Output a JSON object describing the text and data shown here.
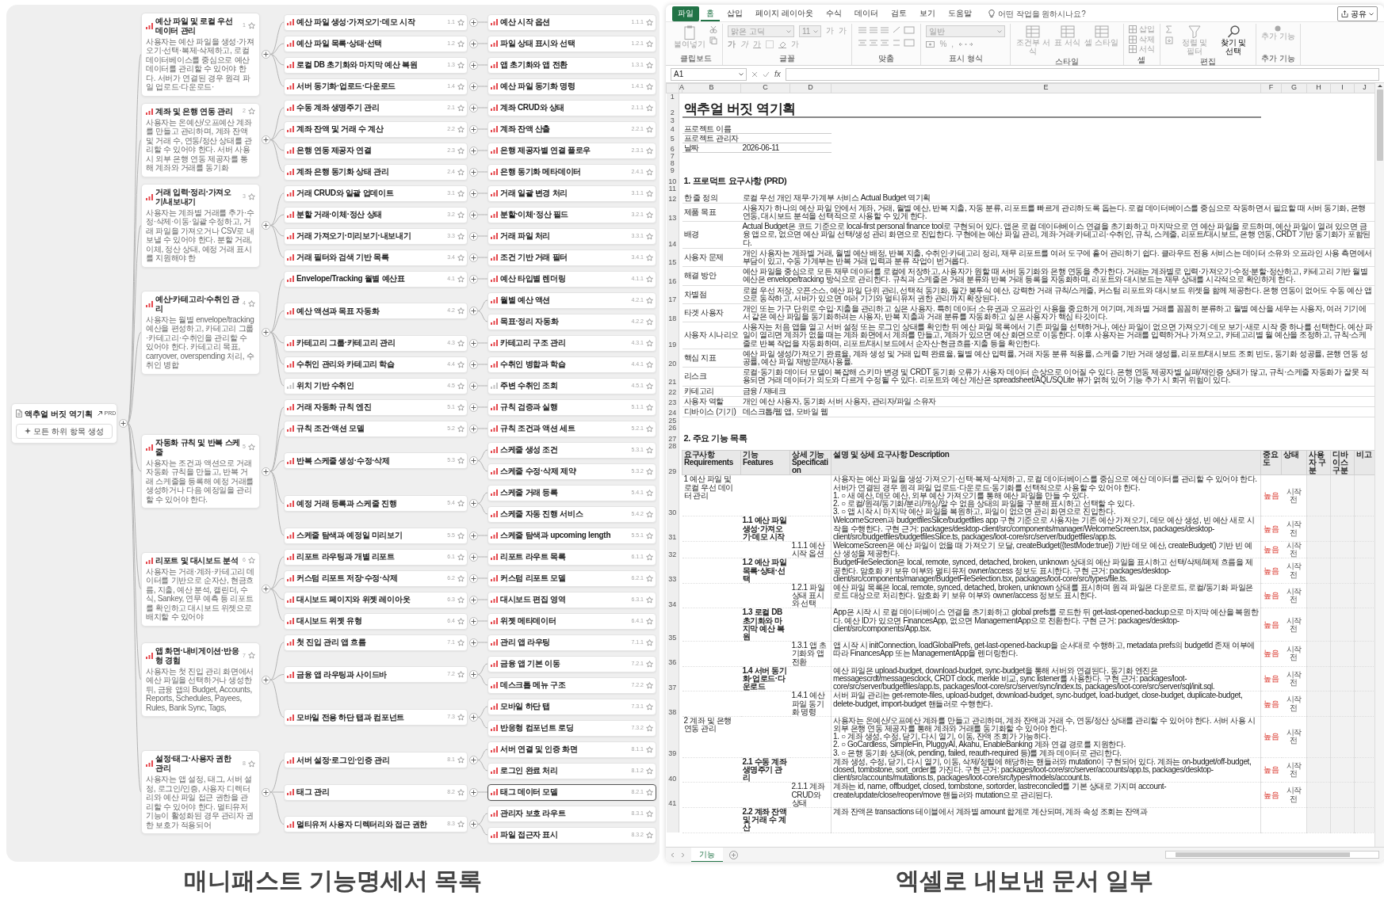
{
  "mindmap": {
    "caption": "매니패스트 기능명세서 목록",
    "root": {
      "title": "액추얼 버짓 역기획",
      "badge": "PRD",
      "action": "모든 하위 항목 생성"
    },
    "features": [
      {
        "number": "1",
        "title": "예산 파일 및 로컬 우선 데이터 관리",
        "color": "#e5484d",
        "description": "사용자는 예산 파일을 생성·가져오기·선택·복제·삭제하고, 로컬 데이터베이스를 중심으로 예산 데이터를 관리할 수 있어야 한다. 서버가 연결된 경우 원격 파일 업로드·다운로드·",
        "children": [
          {
            "number": "1.1",
            "title": "예산 파일 생성·가져오기·데모 시작",
            "color": "#e5484d",
            "children": [
              {
                "number": "1.1.1",
                "title": "예산 시작 옵션",
                "color": "#e5484d",
                "selected": false
              }
            ]
          },
          {
            "number": "1.2",
            "title": "예산 파일 목록·상태·선택",
            "color": "#e5484d",
            "children": [
              {
                "number": "1.2.1",
                "title": "파일 상태 표시와 선택",
                "color": "#e5484d",
                "selected": false
              }
            ]
          },
          {
            "number": "1.3",
            "title": "로컬 DB 초기화와 마지막 예산 복원",
            "color": "#e5484d",
            "children": [
              {
                "number": "1.3.1",
                "title": "앱 초기화와 앱 전환",
                "color": "#e5484d",
                "selected": false
              }
            ]
          },
          {
            "number": "1.4",
            "title": "서버 동기화·업로드·다운로드",
            "color": "#e5484d",
            "children": [
              {
                "number": "1.4.1",
                "title": "예산 파일 동기화 명령",
                "color": "#e5484d",
                "selected": false
              }
            ]
          }
        ]
      },
      {
        "number": "2",
        "title": "계좌 및 은행 연동 관리",
        "color": "#e5484d",
        "description": "사용자는 온예산/오프예산 계좌를 만들고 관리하며, 계좌 잔액 및 거래 수, 연동/정산 상태를 관리할 수 있어야 한다. 서버 사용 시 외부 은행 연동 제공자를 통해 계좌와 거래를 동기화",
        "children": [
          {
            "number": "2.1",
            "title": "수동 계좌 생명주기 관리",
            "color": "#e5484d",
            "children": [
              {
                "number": "2.1.1",
                "title": "계좌 CRUD와 상태",
                "color": "#e5484d",
                "selected": false
              }
            ]
          },
          {
            "number": "2.2",
            "title": "계좌 잔액 및 거래 수 계산",
            "color": "#e5484d",
            "children": [
              {
                "number": "2.2.1",
                "title": "계좌 잔액 산출",
                "color": "#e5484d",
                "selected": false
              }
            ]
          },
          {
            "number": "2.3",
            "title": "은행 연동 제공자 연결",
            "color": "#e5484d",
            "children": [
              {
                "number": "2.3.1",
                "title": "은행 제공자별 연결 플로우",
                "color": "#e5484d",
                "selected": false
              }
            ]
          },
          {
            "number": "2.4",
            "title": "계좌 은행 동기화 상태 관리",
            "color": "#e5484d",
            "children": [
              {
                "number": "2.4.1",
                "title": "은행 동기화 메타데이터",
                "color": "#e5484d",
                "selected": false
              }
            ]
          }
        ]
      },
      {
        "number": "3",
        "title": "거래 입력·정리·가져오기/내보내기",
        "color": "#e5484d",
        "description": "사용자는 계좌별 거래를 추가·수정·삭제·이동·일괄 수정하고, 거래 파일을 가져오거나 CSV로 내보낼 수 있어야 한다. 분할 거래, 이체, 정산 상태, 예정 거래 표시를 지원해야 한",
        "children": [
          {
            "number": "3.1",
            "title": "거래 CRUD와 일괄 업데이트",
            "color": "#e5484d",
            "children": [
              {
                "number": "3.1.1",
                "title": "거래 일괄 변경 처리",
                "color": "#e5484d",
                "selected": false
              }
            ]
          },
          {
            "number": "3.2",
            "title": "분할 거래·이체·정산 상태",
            "color": "#e5484d",
            "children": [
              {
                "number": "3.2.1",
                "title": "분할·이체·정산 필드",
                "color": "#e5484d",
                "selected": false
              }
            ]
          },
          {
            "number": "3.3",
            "title": "거래 가져오기·미리보기·내보내기",
            "color": "#e5484d",
            "children": [
              {
                "number": "3.3.1",
                "title": "거래 파일 처리",
                "color": "#e5484d",
                "selected": false
              }
            ]
          },
          {
            "number": "3.4",
            "title": "거래 필터와 검색 기반 목록",
            "color": "#e5484d",
            "children": [
              {
                "number": "3.4.1",
                "title": "조건 기반 거래 필터",
                "color": "#e5484d",
                "selected": false
              }
            ]
          }
        ]
      },
      {
        "number": "4",
        "title": "예산·카테고리·수취인 관리",
        "color": "#e5484d",
        "description": "사용자는 월별 envelope/tracking 예산을 편성하고, 카테고리 그룹·카테고리·수취인을 관리할 수 있어야 한다. 카테고리 목표, carryover, overspending 처리, 수취인 병합",
        "children": [
          {
            "number": "4.1",
            "title": "Envelope/Tracking 월별 예산표",
            "color": "#e5484d",
            "children": [
              {
                "number": "4.1.1",
                "title": "예산 타입별 렌더링",
                "color": "#e5484d",
                "selected": false
              }
            ]
          },
          {
            "number": "4.2",
            "title": "예산 액션과 목표 자동화",
            "color": "#e5484d",
            "children": [
              {
                "number": "4.2.1",
                "title": "월별 예산 액션",
                "color": "#e5484d",
                "selected": false
              },
              {
                "number": "4.2.2",
                "title": "목표·정리 자동화",
                "color": "#e5484d",
                "selected": false
              }
            ]
          },
          {
            "number": "4.3",
            "title": "카테고리 그룹·카테고리 관리",
            "color": "#e5484d",
            "children": [
              {
                "number": "4.3.1",
                "title": "카테고리 구조 관리",
                "color": "#e5484d",
                "selected": false
              }
            ]
          },
          {
            "number": "4.4",
            "title": "수취인 관리와 카테고리 학습",
            "color": "#e5484d",
            "children": [
              {
                "number": "4.4.1",
                "title": "수취인 병합과 학습",
                "color": "#e5484d",
                "selected": false
              }
            ]
          },
          {
            "number": "4.5",
            "title": "위치 기반 수취인",
            "color": "#c4c4c4",
            "children": [
              {
                "number": "4.5.1",
                "title": "주변 수취인 조회",
                "color": "#c4c4c4",
                "selected": false
              }
            ]
          }
        ]
      },
      {
        "number": "5",
        "title": "자동화 규칙 및 반복 스케줄",
        "color": "#e5484d",
        "description": "사용자는 조건과 액션으로 거래 자동화 규칙을 만들고, 반복 거래 스케줄을 등록해 예정 거래를 생성하거나 다음 예정일을 관리할 수 있어야 한다.",
        "children": [
          {
            "number": "5.1",
            "title": "거래 자동화 규칙 엔진",
            "color": "#e5484d",
            "children": [
              {
                "number": "5.1.1",
                "title": "규칙 검증과 실행",
                "color": "#e5484d",
                "selected": false
              }
            ]
          },
          {
            "number": "5.2",
            "title": "규칙 조건·액션 모델",
            "color": "#e5484d",
            "children": [
              {
                "number": "5.2.1",
                "title": "규칙 조건과 액션 세트",
                "color": "#e5484d",
                "selected": false
              }
            ]
          },
          {
            "number": "5.3",
            "title": "반복 스케줄 생성·수정·삭제",
            "color": "#e5484d",
            "children": [
              {
                "number": "5.3.1",
                "title": "스케줄 생성 조건",
                "color": "#e5484d",
                "selected": false
              },
              {
                "number": "5.3.2",
                "title": "스케줄 수정·삭제 제약",
                "color": "#e5484d",
                "selected": false
              }
            ]
          },
          {
            "number": "5.4",
            "title": "예정 거래 등록과 스케줄 진행",
            "color": "#e5484d",
            "children": [
              {
                "number": "5.4.1",
                "title": "스케줄 거래 등록",
                "color": "#e5484d",
                "selected": false
              },
              {
                "number": "5.4.2",
                "title": "스케줄 자동 진행 서비스",
                "color": "#e5484d",
                "selected": false
              }
            ]
          },
          {
            "number": "5.5",
            "title": "스케줄 탐색과 예정일 미리보기",
            "color": "#e5484d",
            "children": [
              {
                "number": "5.5.1",
                "title": "스케줄 탐색과 upcoming length",
                "color": "#e5484d",
                "selected": false
              }
            ]
          }
        ]
      },
      {
        "number": "6",
        "title": "리포트 및 대시보드 분석",
        "color": "#e5484d",
        "description": "사용자는 거래·계좌·카테고리 데이터를 기반으로 순자산, 현금흐름, 지출, 예산 분석, 캘린더, 수식, Sankey, 연무 예측 등 리포트를 확인하고 대시보드 위젯으로 배치할 수 있어야",
        "children": [
          {
            "number": "6.1",
            "title": "리포트 라우팅과 개별 리포트",
            "color": "#e5484d",
            "children": [
              {
                "number": "6.1.1",
                "title": "리포트 라우트 목록",
                "color": "#e5484d",
                "selected": false
              }
            ]
          },
          {
            "number": "6.2",
            "title": "커스텀 리포트 저장·수정·삭제",
            "color": "#e5484d",
            "children": [
              {
                "number": "6.2.1",
                "title": "커스텀 리포트 모델",
                "color": "#e5484d",
                "selected": false
              }
            ]
          },
          {
            "number": "6.3",
            "title": "대시보드 페이지와 위젯 레이아웃",
            "color": "#e5484d",
            "children": [
              {
                "number": "6.3.1",
                "title": "대시보드 편집 영역",
                "color": "#e5484d",
                "selected": false
              }
            ]
          },
          {
            "number": "6.4",
            "title": "대시보드 위젯 유형",
            "color": "#e5484d",
            "children": [
              {
                "number": "6.4.1",
                "title": "위젯 메타데이터",
                "color": "#e5484d",
                "selected": false
              }
            ]
          }
        ]
      },
      {
        "number": "7",
        "title": "앱 화면·내비게이션·반응형 경험",
        "color": "#e5484d",
        "description": "사용자는 첫 진입 관리 화면에서 예산 파일을 선택하거나 생성한 뒤, 금융 앱의 Budget, Accounts, Reports, Schedules, Payees, Rules, Bank Sync, Tags,",
        "children": [
          {
            "number": "7.1",
            "title": "첫 진입 관리 앱 흐름",
            "color": "#e5484d",
            "children": [
              {
                "number": "7.1.1",
                "title": "관리 앱 라우팅",
                "color": "#e5484d",
                "selected": false
              }
            ]
          },
          {
            "number": "7.2",
            "title": "금융 앱 라우팅과 사이드바",
            "color": "#e5484d",
            "children": [
              {
                "number": "7.2.1",
                "title": "금융 앱 기본 이동",
                "color": "#e5484d",
                "selected": false
              },
              {
                "number": "7.2.2",
                "title": "데스크톱 메뉴 구조",
                "color": "#e5484d",
                "selected": false
              }
            ]
          },
          {
            "number": "7.3",
            "title": "모바일 전용 하단 탭과 컴포넌트",
            "color": "#e5484d",
            "children": [
              {
                "number": "7.3.1",
                "title": "모바일 하단 탭",
                "color": "#e5484d",
                "selected": false
              },
              {
                "number": "7.3.2",
                "title": "반응형 컴포넌트 로딩",
                "color": "#e5484d",
                "selected": false
              }
            ]
          }
        ]
      },
      {
        "number": "8",
        "title": "설정·태그·사용자 권한 관리",
        "color": "#e5484d",
        "description": "사용자는 앱 설정, 태그, 서버 설정, 로그인/인증, 사용자 디렉터리와 예산 파일 접근 권한을 관리할 수 있어야 한다. 멀티유저 기능이 활성화된 경우 관리자 권한 보호가 적용되어",
        "children": [
          {
            "number": "8.1",
            "title": "서버 설정·로그인·인증 관리",
            "color": "#e5484d",
            "children": [
              {
                "number": "8.1.1",
                "title": "서버 연결 및 인증 화면",
                "color": "#e5484d",
                "selected": false
              },
              {
                "number": "8.1.2",
                "title": "로그인 완료 처리",
                "color": "#e5484d",
                "selected": false
              }
            ]
          },
          {
            "number": "8.2",
            "title": "태그 관리",
            "color": "#e5484d",
            "children": [
              {
                "number": "8.2.1",
                "title": "태그 데이터 모델",
                "color": "#e5484d",
                "selected": true
              }
            ]
          },
          {
            "number": "8.3",
            "title": "멀티유저 사용자 디렉터리와 접근 권한",
            "color": "#e5484d",
            "children": [
              {
                "number": "8.3.1",
                "title": "관리자 보호 라우트",
                "color": "#e5484d",
                "selected": false
              },
              {
                "number": "8.3.2",
                "title": "파일 접근자 표시",
                "color": "#e5484d",
                "selected": false
              }
            ]
          }
        ]
      }
    ]
  },
  "excel": {
    "caption": "엑셀로 내보낸 문서 일부",
    "tabs": [
      {
        "label": "파일",
        "kind": "file",
        "selected": false
      },
      {
        "label": "홈",
        "kind": "tab",
        "selected": true
      },
      {
        "label": "삽입",
        "kind": "tab",
        "selected": false
      },
      {
        "label": "페이지 레이아웃",
        "kind": "tab",
        "selected": false
      },
      {
        "label": "수식",
        "kind": "tab",
        "selected": false
      },
      {
        "label": "데이터",
        "kind": "tab",
        "selected": false
      },
      {
        "label": "검토",
        "kind": "tab",
        "selected": false
      },
      {
        "label": "보기",
        "kind": "tab",
        "selected": false
      },
      {
        "label": "도움말",
        "kind": "tab",
        "selected": false
      }
    ],
    "tell_me": "어떤 작업을 원하시나요?",
    "share": "공유",
    "ribbon": [
      {
        "label": "클립보드",
        "kind": "clipboard",
        "buttons": [
          {
            "label": "붙여넣기",
            "disabled": true
          }
        ]
      },
      {
        "label": "글꼴",
        "kind": "font",
        "font_name": "맑은 고딕",
        "font_size": "11",
        "buttons": [
          {
            "label": "가",
            "disabled": true
          },
          {
            "label": "가",
            "disabled": true
          },
          {
            "label": "가",
            "disabled": true
          },
          {
            "label": "가",
            "disabled": true
          },
          {
            "label": "가",
            "disabled": true
          },
          {
            "label": "가",
            "disabled": true
          }
        ]
      },
      {
        "label": "맞춤",
        "kind": "align"
      },
      {
        "label": "표시 형식",
        "kind": "number",
        "format": "일반",
        "buttons": [
          {
            "label": "%",
            "disabled": true
          },
          {
            "label": ",",
            "disabled": true
          }
        ]
      },
      {
        "label": "스타일",
        "kind": "styles",
        "buttons": [
          {
            "label": "조건부 서식",
            "disabled": true
          },
          {
            "label": "표 서식",
            "disabled": true
          },
          {
            "label": "셀 스타일",
            "disabled": true
          }
        ]
      },
      {
        "label": "셀",
        "kind": "cells",
        "buttons": [
          {
            "label": "삽입",
            "disabled": true
          },
          {
            "label": "삭제",
            "disabled": true
          },
          {
            "label": "서식",
            "disabled": true
          }
        ]
      },
      {
        "label": "편집",
        "kind": "editing",
        "buttons": [
          {
            "label": "정렬 및 필터",
            "disabled": true
          },
          {
            "label": "찾기 및 선택",
            "disabled": false
          }
        ]
      },
      {
        "label": "추가 기능",
        "kind": "addins",
        "buttons": [
          {
            "label": "추가 기능",
            "disabled": true
          }
        ]
      }
    ],
    "name_box": "A1",
    "function_label": "fx",
    "columns": [
      "A",
      "B",
      "C",
      "D",
      "E",
      "F",
      "G",
      "H",
      "I",
      "J"
    ],
    "rows": [
      {
        "number": "1",
        "kind": "blank"
      },
      {
        "number": "2",
        "kind": "title",
        "text": "액추얼 버짓 역기획"
      },
      {
        "number": "3",
        "kind": "blank"
      },
      {
        "number": "4",
        "kind": "info",
        "label": "프로젝트 이름"
      },
      {
        "number": "5",
        "kind": "info",
        "label": "프로젝트 관리자"
      },
      {
        "number": "6",
        "kind": "info",
        "label": "날짜",
        "value": "2026-06-11"
      },
      {
        "number": "7",
        "kind": "blank"
      },
      {
        "number": "8",
        "kind": "blank"
      },
      {
        "number": "9",
        "kind": "blank"
      },
      {
        "number": "10",
        "kind": "heading",
        "text": "1. 프로덕트 요구사항 (PRD)"
      },
      {
        "number": "11",
        "kind": "blank"
      },
      {
        "number": "12",
        "kind": "field",
        "label": "한 줄 정의",
        "value": "로컬 우선 개인 재무·가계부 서비스 Actual Budget 역기획"
      },
      {
        "number": "13",
        "kind": "field",
        "label": "제품 목표",
        "value": "사용자가 하나의 예산 파일 안에서 계좌, 거래, 월별 예산, 반복 지출, 자동 분류, 리포트를 빠르게 관리하도록 돕는다. 로컬 데이터베이스를 중심으로 작동하면서 필요할 때 서버 동기화, 은행 연동, 대시보드 분석을 선택적으로 사용할 수 있게 한다."
      },
      {
        "number": "14",
        "kind": "field",
        "label": "배경",
        "value": "Actual Budget은 코드 기준으로 local-first personal finance tool로 구현되어 있다. 앱은 로컬 데이터베이스 연결을 초기화하고 마지막으로 연 예산 파일을 로드하며, 예산 파일이 열려 있으면 금융 앱으로, 없으면 예산 파일 선택/생성 관리 화면으로 진입한다. 구현에는 예산 파일 관리, 계좌·거래·카테고리·수취인, 규칙, 스케줄, 리포트/대시보드, 은행 연동, CRDT 기반 동기화가 포함된다."
      },
      {
        "number": "15",
        "kind": "field",
        "label": "사용자 문제",
        "value": "개인 사용자는 계좌별 거래, 월별 예산 배정, 반복 지출, 수취인·카테고리 정리, 재무 리포트를 여러 도구에 흩어 관리하기 쉽다. 클라우드 전용 서비스는 데이터 소유와 오프라인 사용 측면에서 부담이 있고, 수동 가계부는 반복 거래 입력과 분류 작업이 번거롭다."
      },
      {
        "number": "16",
        "kind": "field",
        "label": "해결 방안",
        "value": "예산 파일을 중심으로 모든 재무 데이터를 로컬에 저장하고, 사용자가 원할 때 서버 동기화와 은행 연동을 추가한다. 거래는 계좌별로 입력·가져오기·수정·분할·정산하고, 카테고리 기반 월별 예산은 envelope/tracking 방식으로 관리한다. 규칙과 스케줄은 거래 분류와 반복 거래 등록을 자동화하며, 리포트와 대시보드는 재무 상태를 시각적으로 확인하게 한다."
      },
      {
        "number": "17",
        "kind": "field",
        "label": "차별점",
        "value": "로컬 우선 저장, 오픈소스, 예산 파일 단위 관리, 선택적 동기화, 월간 봉투식 예산, 강력한 거래 규칙/스케줄, 커스텀 리포트와 대시보드 위젯을 함께 제공한다. 은행 연동이 없어도 수동 예산 앱으로 동작하고, 서버가 있으면 여러 기기와 멀티유저 권한 관리까지 확장된다."
      },
      {
        "number": "18",
        "kind": "field",
        "label": "타겟 사용자",
        "value": "개인 또는 가구 단위로 수입·지출을 관리하고 싶은 사용자. 특히 데이터 소유권과 오프라인 사용을 중요하게 여기며, 계좌별 거래를 꼼꼼히 분류하고 월별 예산을 세우는 사용자, 여러 기기에서 같은 예산 파일을 동기화하려는 사용자, 반복 지출과 거래 분류를 자동화하고 싶은 사용자가 핵심 타깃이다."
      },
      {
        "number": "19",
        "kind": "field",
        "label": "사용자 시나리오",
        "value": "사용자는 처음 앱을 열고 서버 설정 또는 로그인 상태를 확인한 뒤 예산 파일 목록에서 기존 파일을 선택하거나, 예산 파일이 없으면 가져오기·데모 보기·새로 시작 중 하나를 선택한다. 예산 파일이 열리면 계좌가 없을 때는 계좌 화면에서 계좌를 만들고, 계좌가 있으면 예산 화면으로 이동한다. 이후 사용자는 거래를 입력하거나 가져오고, 카테고리별 월 예산을 조정하고, 규칙·스케줄로 반복 작업을 자동화하며, 리포트/대시보드에서 순자산·현금흐름·지출 등을 확인한다."
      },
      {
        "number": "20",
        "kind": "field",
        "label": "핵심 지표",
        "value": "예산 파일 생성/가져오기 완료율, 계좌 생성 및 거래 입력 완료율, 월별 예산 입력률, 거래 자동 분류 적용률, 스케줄 기반 거래 생성률, 리포트/대시보드 조회 빈도, 동기화 성공률, 은행 연동 성공률, 예산 파일 재방문/재사용률."
      },
      {
        "number": "21",
        "kind": "field",
        "label": "리스크",
        "value": "로컬·동기화 데이터 모델이 복잡해 스키마 변경 및 CRDT 동기화 오류가 사용자 데이터 손상으로 이어질 수 있다. 은행 연동 제공자별 실패/재인증 상태가 많고, 규칙·스케줄 자동화가 잘못 적용되면 거래 데이터가 의도와 다르게 수정될 수 있다. 리포트와 예산 계산은 spreadsheet/AQL/SQLite 뷰가 얽혀 있어 기능 추가 시 회귀 위험이 있다."
      },
      {
        "number": "22",
        "kind": "field",
        "label": "카테고리",
        "value": "금융 / 재테크"
      },
      {
        "number": "23",
        "kind": "field",
        "label": "사용자 역할",
        "value": "개인 예산 사용자, 동기화 서버 사용자, 관리자/파일 소유자"
      },
      {
        "number": "24",
        "kind": "field",
        "label": "디바이스 (기기)",
        "value": "데스크톱/웹 앱, 모바일 웹"
      },
      {
        "number": "25",
        "kind": "blank"
      },
      {
        "number": "26",
        "kind": "blank"
      },
      {
        "number": "27",
        "kind": "heading",
        "text": "2. 주요 기능 목록"
      },
      {
        "number": "28",
        "kind": "blank"
      },
      {
        "number": "29",
        "kind": "table_header",
        "cells": [
          "요구사항 Requirements",
          "기능 Features",
          "상세 기능 Specification",
          "설명 및 상세 요구사항 Description",
          "중요도",
          "상태",
          "사용자 구분",
          "디바이스 구분",
          "비고"
        ]
      },
      {
        "number": "30",
        "kind": "table_row",
        "requirement": "1 예산 파일 및 로컬 우선 데이터 관리",
        "description": "사용자는 예산 파일을 생성·가져오기·선택·복제·삭제하고, 로컬 데이터베이스를 중심으로 예산 데이터를 관리할 수 있어야 한다. 서버가 연결된 경우 원격 파일 업로드·다운로드·동기화를 선택적으로 사용할 수 있어야 한다.\n1. ○ 새 예산, 데모 예산, 외부 예산 가져오기를 통해 예산 파일을 만들 수 있다.\n2. ○ 로컬/원격/동기화/분리/캐싱/알 수 없음 상태의 파일을 구분해 표시하고 선택할 수 있다.\n3. ○ 앱 시작 시 마지막 예산 파일을 복원하고, 파일이 없으면 관리 화면으로 진입한다.",
        "importance": "높음",
        "status": "시작전"
      },
      {
        "number": "31",
        "kind": "table_row",
        "feature": "1.1 예산 파일 생성·가져오기·데모 시작",
        "description": "WelcomeScreen과 budgetfilesSlice/budgetfiles app 구현 기준으로 사용자는 기존 예산 가져오기, 데모 예산 생성, 빈 예산 새로 시작을 수행한다. 구현 근거: packages/desktop-client/src/components/manager/WelcomeScreen.tsx, packages/desktop-client/src/budgetfiles/budgetfilesSlice.ts, packages/loot-core/src/server/budgetfiles/app.ts.",
        "importance": "높음",
        "status": "시작전"
      },
      {
        "number": "32",
        "kind": "table_row",
        "specification": "1.1.1 예산 시작 옵션",
        "description": "WelcomeScreen은 예산 파일이 없을 때 가져오기 모달, createBudget({testMode:true}) 기반 데모 예산, createBudget() 기반 빈 예산 생성을 제공한다.",
        "importance": "높음",
        "status": "시작전"
      },
      {
        "number": "33",
        "kind": "table_row",
        "feature": "1.2 예산 파일 목록·상태·선택",
        "description": "BudgetFileSelection은 local, remote, synced, detached, broken, unknown 상태의 예산 파일을 표시하고 선택/삭제/폐제 흐름을 제공한다. 암호화 키 보유 여부와 멀티유저 owner/access 정보도 표시한다. 구현 근거: packages/desktop-client/src/components/manager/BudgetFileSelection.tsx, packages/loot-core/src/types/file.ts.",
        "importance": "높음",
        "status": "시작전"
      },
      {
        "number": "34",
        "kind": "table_row",
        "specification": "1.2.1 파일 상태 표시와 선택",
        "description": "예산 파일 목록은 local, remote, synced, detached, broken, unknown 상태를 표시하며 원격 파일은 다운로드, 로컬/동기화 파일은 로드 대상으로 처리한다. 암호화 키 보유 여부와 owner/access 정보도 표시한다.",
        "importance": "높음",
        "status": "시작전"
      },
      {
        "number": "35",
        "kind": "table_row",
        "feature": "1.3 로컬 DB 초기화와 마지막 예산 복원",
        "description": "App은 시작 시 로컬 데이터베이스 연결을 초기화하고 global prefs를 로드한 뒤 get-last-opened-backup으로 마지막 예산을 복원한다. 예산 ID가 있으면 FinancesApp, 없으면 ManagementApp으로 전환한다. 구현 근거: packages/desktop-client/src/components/App.tsx.",
        "importance": "높음",
        "status": "시작전"
      },
      {
        "number": "36",
        "kind": "table_row",
        "specification": "1.3.1 앱 초기화와 앱 전환",
        "description": "앱 시작 시 initConnection, loadGlobalPrefs, get-last-opened-backup을 순서대로 수행하고, metadata prefs의 budgetId 존재 여부에 따라 FinancesApp 또는 ManagementApp을 렌더링한다.",
        "importance": "높음",
        "status": "시작전"
      },
      {
        "number": "37",
        "kind": "table_row",
        "feature": "1.4 서버 동기화·업로드·다운로드",
        "description": "예산 파일은 upload-budget, download-budget, sync-budget을 통해 서버와 연결된다. 동기화 엔진은 messagescrdt/messagesclock, CRDT clock, merkle 비교, sync listener를 사용한다. 구현 근거: packages/loot-core/src/server/budgetfiles/app.ts, packages/loot-core/src/server/sync/index.ts, packages/loot-core/src/server/sql/init.sql.",
        "importance": "높음",
        "status": "시작전"
      },
      {
        "number": "38",
        "kind": "table_row",
        "specification": "1.4.1 예산 파일 동기화 명령",
        "description": "서버 파일 관리는 get-remote-files, upload-budget, download-budget, sync-budget, load-budget, close-budget, duplicate-budget, delete-budget, import-budget 핸들러로 수행한다.",
        "importance": "높음",
        "status": "시작전"
      },
      {
        "number": "39",
        "kind": "table_row",
        "requirement": "2 계좌 및 은행 연동 관리",
        "description": "사용자는 온예산/오프예산 계좌를 만들고 관리하며, 계좌 잔액과 거래 수, 연동/정산 상태를 관리할 수 있어야 한다. 서버 사용 시 외부 은행 연동 제공자를 통해 계좌와 거래를 동기화할 수 있어야 한다.\n1. ○ 계좌 생성, 수정, 닫기, 다시 열기, 이동, 잔액 조회가 가능하다.\n2. ○ GoCardless, SimpleFin, PluggyAI, Akahu, EnableBanking 계좌 연결 경로를 지원한다.\n3. ○ 은행 동기화 상태(ok, pending, failed, reauth-required 등)를 계좌 데이터로 관리한다.",
        "importance": "높음",
        "status": "시작전"
      },
      {
        "number": "40",
        "kind": "table_row",
        "feature": "2.1 수동 계좌 생명주기 관리",
        "description": "계좌 생성, 수정, 닫기, 다시 열기, 이동, 삭제/정렬에 해당하는 핸들러와 mutation이 구현되어 있다. 계좌는 on-budget/off-budget, closed, tombstone, sort_order를 가진다. 구현 근거: packages/loot-core/src/server/accounts/app.ts, packages/desktop-client/src/accounts/mutations.ts, packages/loot-core/src/types/models/account.ts.",
        "importance": "높음",
        "status": "시작전"
      },
      {
        "number": "41",
        "kind": "table_row",
        "specification": "2.1.1 계좌 CRUD와 상태",
        "description": "계좌는 id, name, offbudget, closed, tombstone, sortorder, lastreconciled를 기본 상태로 가지며 account-create/update/close/reopen/move 핸들러와 mutation으로 관리된다.",
        "importance": "높음",
        "status": "시작전"
      },
      {
        "kind": "table_row",
        "feature": "2.2 계좌 잔액 및 거래 수 계산",
        "description": "계좌 잔액은 transactions 테이블에서 계좌별 amount 합계로 계산되며, 계좌 속성 조회는 잔액과"
      }
    ],
    "sheets": [
      {
        "label": "기능",
        "selected": true
      }
    ]
  }
}
